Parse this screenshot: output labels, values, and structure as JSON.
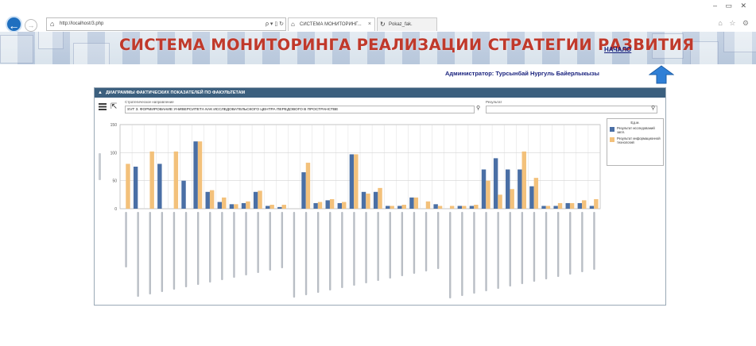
{
  "browser": {
    "address": "http://localhost/3.php",
    "address_tools": "ρ ▾ ▯ ↻",
    "tabs": [
      {
        "label": "СИСТЕМА МОНИТОРИНГ...",
        "active": true
      },
      {
        "label": "Pokaz_fak.",
        "active": false
      }
    ],
    "window_controls": "– ▭ ✕",
    "toolbar_icons": "⌂ ☆ ⚙"
  },
  "banner": {
    "title": "СИСТЕМА МОНИТОРИНГА РЕАЛИЗАЦИИ СТРАТЕГИИ РАЗВИТИЯ",
    "home_link": "НАЧАЛО"
  },
  "user": {
    "admin_line": "Администратор: Турсынбай Нургуль Байерлыкызы"
  },
  "panel": {
    "header": "ДИАГРАММЫ ФАКТИЧЕСКИХ ПОКАЗАТЕЛЕЙ ПО ФАКУЛЬТЕТАМ",
    "direction_label": "Стратегическое направление",
    "direction_value": "SVT 3. ФОРМИРОВАНИЕ УНИВЕРСИТЕТА КАК ИССЛЕДОВАТЕЛЬСКОГО ЦЕНТРА ПЕРЕДОВОГО В ПРОСТРАНСТВЕ",
    "result_label": "Результат",
    "result_value": ""
  },
  "legend": {
    "title": "Ед.м.",
    "items": [
      {
        "label": "Результат исследований запл.",
        "color": "#4a6fa5"
      },
      {
        "label": "Результат информационной технологий",
        "color": "#f3c17b"
      }
    ]
  },
  "chart_data": {
    "type": "bar",
    "ylim": [
      0,
      150
    ],
    "yticks": [
      0,
      50,
      100,
      150
    ],
    "grid": true,
    "legend_position": "right",
    "series": [
      {
        "color": "#4a6fa5",
        "values": [
          0,
          75,
          0,
          80,
          0,
          50,
          120,
          30,
          12,
          8,
          10,
          30,
          5,
          3,
          0,
          65,
          10,
          15,
          10,
          97,
          30,
          30,
          5,
          5,
          20,
          0,
          8,
          0,
          5,
          5,
          70,
          90,
          70,
          70,
          40,
          5,
          5,
          10,
          10,
          5
        ]
      },
      {
        "color": "#f3c17b",
        "values": [
          80,
          0,
          102,
          0,
          102,
          0,
          120,
          33,
          20,
          8,
          13,
          32,
          7,
          7,
          0,
          82,
          12,
          17,
          12,
          97,
          27,
          37,
          5,
          7,
          20,
          13,
          5,
          5,
          5,
          7,
          50,
          25,
          35,
          102,
          55,
          5,
          10,
          10,
          15,
          17
        ]
      }
    ],
    "categories": [
      "",
      "",
      "",
      "",
      "",
      "",
      "",
      "",
      "",
      "",
      "",
      "",
      "",
      "",
      "",
      "",
      "",
      "",
      "",
      "",
      "",
      "",
      "",
      "",
      "",
      "",
      "",
      "",
      "",
      "",
      "",
      "",
      "",
      "",
      "",
      "",
      "",
      "",
      "",
      ""
    ]
  }
}
